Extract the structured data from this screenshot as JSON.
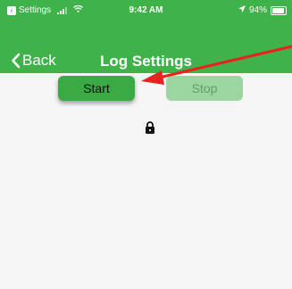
{
  "status_bar": {
    "back_app": "Settings",
    "time": "9:42 AM",
    "battery": "94%",
    "battery_level": 0.94
  },
  "nav": {
    "back_label": "Back",
    "title": "Log Settings"
  },
  "buttons": {
    "start_label": "Start",
    "stop_label": "Stop"
  },
  "icons": {
    "lock": "lock-icon",
    "location": "location-arrow-icon",
    "wifi": "wifi-icon",
    "signal": "signal-bars-icon",
    "battery": "battery-icon",
    "back": "chevron-left-icon"
  },
  "colors": {
    "header_green": "#3fb24a",
    "start_green": "#3aaa45",
    "stop_green_disabled": "#9bd6a0",
    "annotation_arrow": "#e8231f"
  }
}
